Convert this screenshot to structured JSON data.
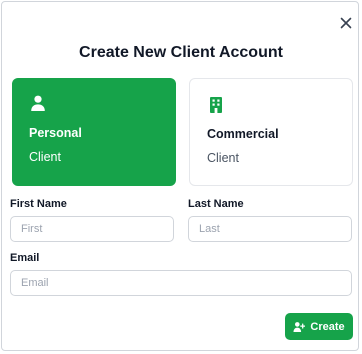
{
  "modal": {
    "title": "Create New Client Account",
    "close_icon": "close-icon"
  },
  "client_types": [
    {
      "name": "Personal",
      "sub": "Client",
      "icon": "user-icon",
      "selected": true
    },
    {
      "name": "Commercial",
      "sub": "Client",
      "icon": "building-icon",
      "selected": false
    }
  ],
  "form": {
    "first_name": {
      "label": "First Name",
      "placeholder": "First",
      "value": ""
    },
    "last_name": {
      "label": "Last Name",
      "placeholder": "Last",
      "value": ""
    },
    "email": {
      "label": "Email",
      "placeholder": "Email",
      "value": ""
    }
  },
  "actions": {
    "create_label": "Create",
    "create_icon": "user-plus-icon"
  },
  "colors": {
    "accent": "#16a34a",
    "border": "#d1d5db",
    "text": "#111827",
    "placeholder": "#9ca3af"
  }
}
